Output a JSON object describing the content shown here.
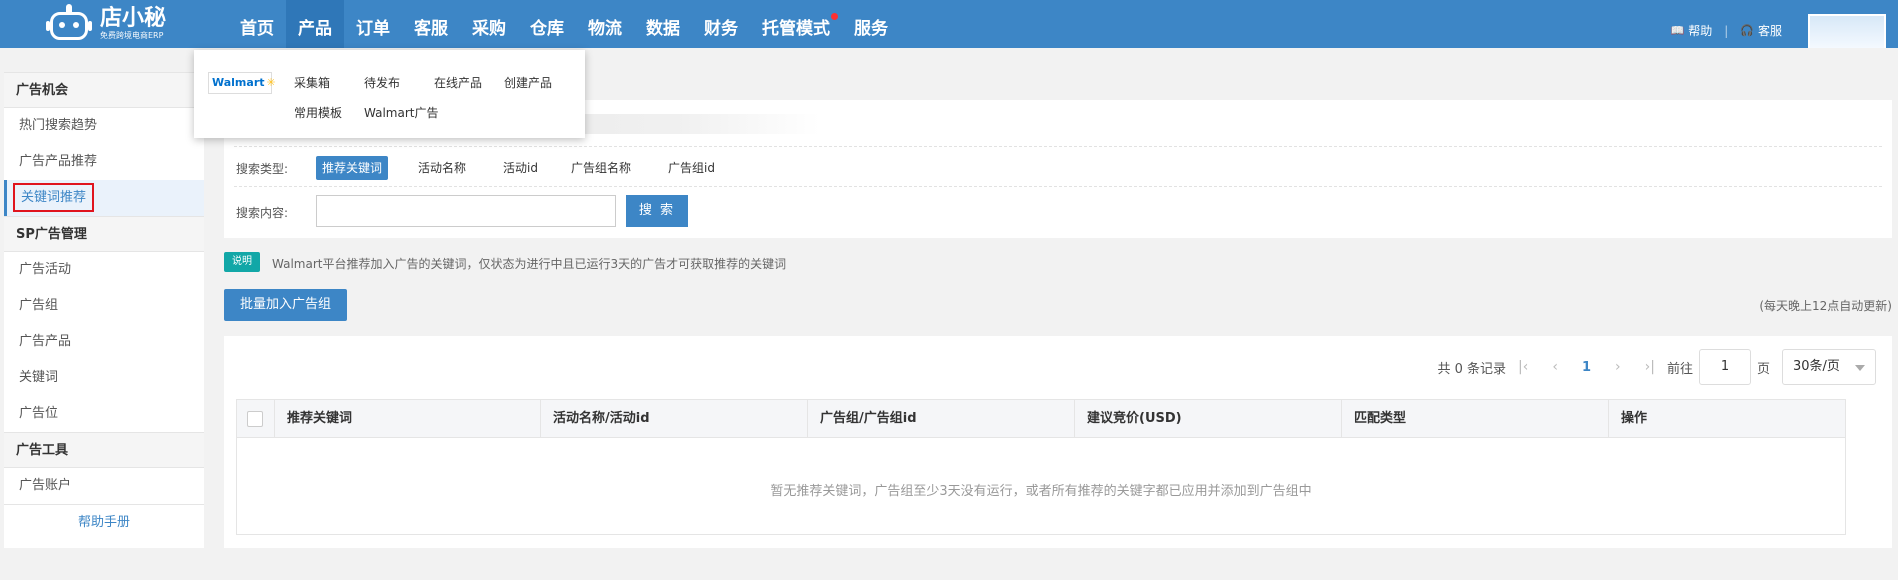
{
  "brand": {
    "name": "店小秘",
    "tagline": "免费跨境电商ERP"
  },
  "nav": {
    "items": [
      "首页",
      "产品",
      "订单",
      "客服",
      "采购",
      "仓库",
      "物流",
      "数据",
      "财务",
      "托管模式",
      "服务"
    ],
    "active_index": 1,
    "help": "帮助",
    "service": "客服"
  },
  "dropdown": {
    "platform": "Walmart",
    "items": [
      "采集箱",
      "待发布",
      "在线产品",
      "创建产品",
      "常用模板",
      "Walmart广告"
    ]
  },
  "sidebar": {
    "sections": [
      {
        "title": "广告机会",
        "items": [
          "热门搜索趋势",
          "广告产品推荐",
          "关键词推荐"
        ]
      },
      {
        "title": "SP广告管理",
        "items": [
          "广告活动",
          "广告组",
          "广告产品",
          "关键词",
          "广告位"
        ]
      },
      {
        "title": "广告工具",
        "items": [
          "广告账户"
        ]
      }
    ],
    "active_item": "关键词推荐",
    "help_link": "帮助手册"
  },
  "filter": {
    "search_type_label": "搜索类型:",
    "search_types": [
      "推荐关键词",
      "活动名称",
      "活动id",
      "广告组名称",
      "广告组id"
    ],
    "active_type": 0,
    "search_content_label": "搜索内容:",
    "search_value": "",
    "search_button": "搜 索"
  },
  "tip": {
    "badge": "说明",
    "text": "Walmart平台推荐加入广告的关键词，仅状态为进行中且已运行3天的广告才可获取推荐的关键词"
  },
  "actions": {
    "batch_add": "批量加入广告组",
    "auto_update": "(每天晚上12点自动更新)"
  },
  "pager": {
    "total": "共 0 条记录",
    "current_page": "1",
    "goto_label": "前往",
    "goto_value": "1",
    "page_unit": "页",
    "page_size": "30条/页"
  },
  "table": {
    "columns": [
      "推荐关键词",
      "活动名称/活动id",
      "广告组/广告组id",
      "建议竞价(USD)",
      "匹配类型",
      "操作"
    ],
    "empty_text": "暂无推荐关键词，广告组至少3天没有运行，或者所有推荐的关键字都已应用并添加到广告组中"
  },
  "colors": {
    "primary": "#3d86c6",
    "accent_red": "#e0141e",
    "badge_teal": "#12a7a7"
  }
}
